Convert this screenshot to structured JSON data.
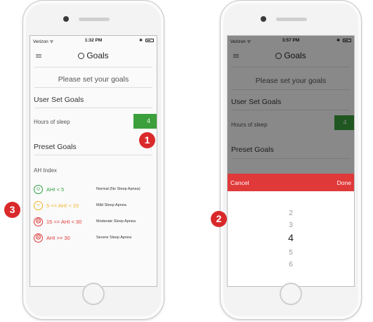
{
  "left_phone": {
    "status": {
      "carrier": "Verizon ᯤ",
      "time": "1:32 PM",
      "bt": "✱"
    },
    "nav_title": "Goals",
    "prompt": "Please set your goals",
    "user_set_goals": "User Set Goals",
    "hours_label": "Hours of sleep",
    "hours_value": "4",
    "preset_goals": "Preset Goals",
    "ah_index": "AH Index",
    "ahi_rows": [
      {
        "range": "AHI < 5",
        "desc": "Normal (No Sleep Apnea)",
        "face": "☺",
        "color": "#2ea043"
      },
      {
        "range": "5 <= AHI < 15",
        "desc": "Mild Sleep Apnea",
        "face": "~",
        "color": "#f0b429"
      },
      {
        "range": "15 <= AHI < 30",
        "desc": "Moderate Sleep Apnea",
        "face": "☹",
        "color": "#e0393a"
      },
      {
        "range": "AHI >= 30",
        "desc": "Severe Sleep Apnea",
        "face": "☹",
        "color": "#e0393a"
      }
    ]
  },
  "right_phone": {
    "status": {
      "carrier": "Verizon ᯤ",
      "time": "3:57 PM",
      "bt": "✱"
    },
    "nav_title": "Goals",
    "prompt": "Please set your goals",
    "user_set_goals": "User Set Goals",
    "hours_label": "Hours of sleep",
    "hours_value": "4",
    "preset_goals": "Preset Goals",
    "picker": {
      "cancel": "Cancel",
      "done": "Done",
      "numbers": [
        "2",
        "3",
        "4",
        "5",
        "6"
      ],
      "selected": "4"
    }
  },
  "callouts": [
    "1",
    "2",
    "3"
  ],
  "colors": {
    "accent_green": "#3b9f3b",
    "accent_red": "#e0393a",
    "callout_red": "#d9292b"
  }
}
